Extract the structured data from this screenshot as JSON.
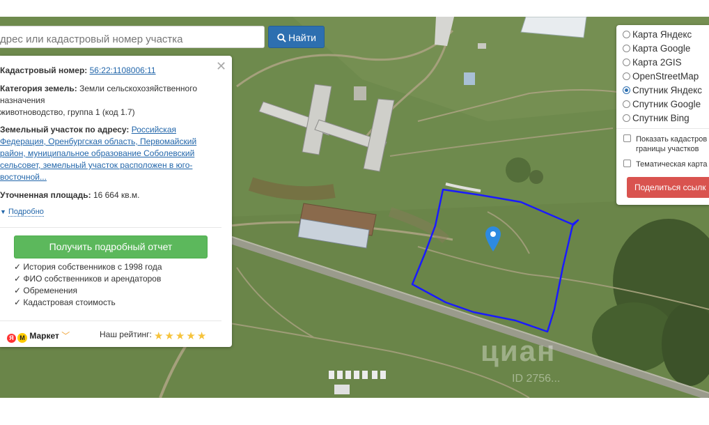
{
  "search": {
    "placeholder": "дрес или кадастровый номер участка",
    "button_label": "Найти"
  },
  "info": {
    "cadastral_label": "Кадастровый номер:",
    "cadastral_value": "56:22:1108006:11",
    "category_label": "Категория земель:",
    "category_value_line1": "Земли сельскохозяйственного",
    "category_value_line2": "назначения",
    "usage_line": "животноводство, группа 1 (код 1.7)",
    "address_label": "Земельный участок по адресу:",
    "address_value_lines": [
      "Российская",
      "Федерация, Оренбургская область, Первомайский",
      "район, муниципальное образование Соболевский",
      "сельсовет, земельный участок расположен в юго-",
      "восточной..."
    ],
    "area_label": "Уточненная площадь:",
    "area_value": "16 664 кв.м.",
    "more_label": "Подробно",
    "report_button": "Получить подробный отчет",
    "features": [
      "✓ История собственников с 1998 года",
      "✓ ФИО собственников и арендаторов",
      "✓ Обременения",
      "✓ Кадастровая стоимость"
    ],
    "market_label": "Маркет",
    "rating_label": "Наш рейтинг:",
    "rating_stars": 5
  },
  "layers": {
    "options": [
      {
        "label": "Карта Яндекс",
        "selected": false
      },
      {
        "label": "Карта Google",
        "selected": false
      },
      {
        "label": "Карта 2GIS",
        "selected": false
      },
      {
        "label": "OpenStreetMap",
        "selected": false
      },
      {
        "label": "Спутник Яндекс",
        "selected": true
      },
      {
        "label": "Спутник Google",
        "selected": false
      },
      {
        "label": "Спутник Bing",
        "selected": false
      }
    ],
    "checkbox_cadastral_line1": "Показать кадастров",
    "checkbox_cadastral_line2": "границы участков",
    "checkbox_thematic": "Тематическая карта",
    "share_button": "Поделиться ссылк"
  },
  "map": {
    "watermark": "циан",
    "watermark_id": "ID 2756..."
  },
  "colors": {
    "accent": "#2d6fb0",
    "report": "#5cb85c",
    "share": "#d9534f",
    "parcel": "#1a1aff",
    "pin": "#2d8ae0"
  }
}
